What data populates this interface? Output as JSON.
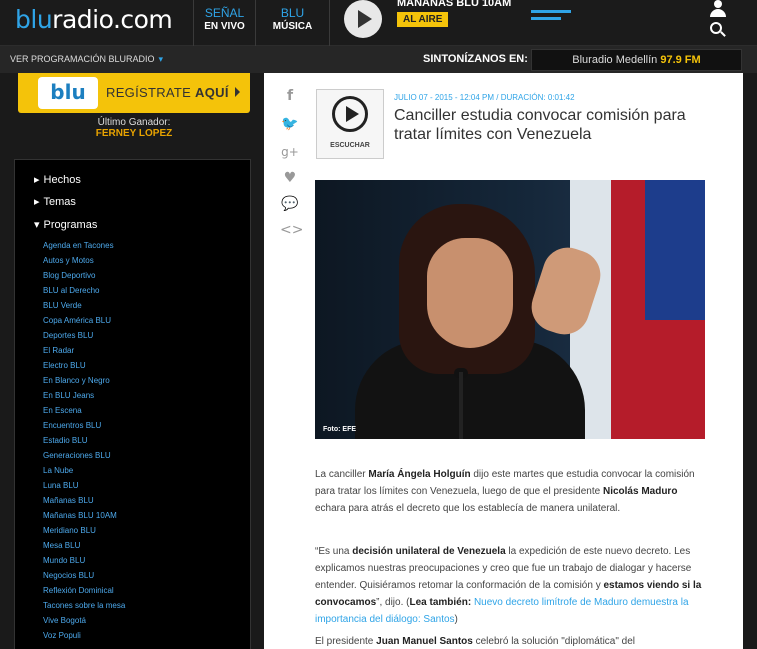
{
  "header": {
    "logo_main": "blu",
    "logo_rest": "radio.com",
    "tab_live": {
      "line1": "SEÑAL",
      "line2": "EN VIVO"
    },
    "tab_music": {
      "line1": "BLU",
      "line2": "MÚSICA"
    },
    "now_show": "MAÑANAS BLU 10AM",
    "live_badge": "AL AIRE"
  },
  "subbar": {
    "schedule_link": "VER PROGRAMACIÓN BLURADIO",
    "schedule_chevron": "▾",
    "tune_label": "SINTONÍZANOS EN:",
    "station_name": "Bluradio Medellín",
    "station_freq": "97.9 FM"
  },
  "sidebar": {
    "register_logo": "blu",
    "register_text": "REGÍSTRATE",
    "register_bold": "AQUÍ",
    "winner_label": "Último Ganador:",
    "winner_name": "FERNEY LOPEZ",
    "sections": {
      "hechos": "Hechos",
      "temas": "Temas",
      "programas": "Programas"
    },
    "programs": [
      "Agenda en Tacones",
      "Autos y Motos",
      "Blog Deportivo",
      "BLU al Derecho",
      "BLU Verde",
      "Copa América BLU",
      "Deportes BLU",
      "El Radar",
      "Electro BLU",
      "En Blanco y Negro",
      "En BLU Jeans",
      "En Escena",
      "Encuentros BLU",
      "Estadio BLU",
      "Generaciones BLU",
      "La Nube",
      "Luna BLU",
      "Mañanas BLU",
      "Mañanas BLU 10AM",
      "Meridiano BLU",
      "Mesa BLU",
      "Mundo BLU",
      "Negocios BLU",
      "Reflexión Dominical",
      "Tacones sobre la mesa",
      "Vive Bogotá",
      "Voz Populi"
    ]
  },
  "article": {
    "share": {
      "facebook": "f",
      "twitter": "🐦",
      "googleplus": "g+",
      "like": "♥",
      "comment": "💬",
      "embed": "<>"
    },
    "listen_label": "ESCUCHAR",
    "meta": "JULIO 07 - 2015 - 12:04 PM / DURACIÓN: 0:01:42",
    "headline": "Canciller estudia convocar comisión para tratar límites con Venezuela",
    "photo_credit": "Foto: EFE",
    "p1": {
      "a": "La canciller ",
      "b": "María Ángela Holguín",
      "c": " dijo este martes que estudia convocar la comisión para tratar los límites con Venezuela, luego de que el presidente ",
      "d": "Nicolás Maduro",
      "e": " echara para atrás el decreto que los establecía de manera unilateral."
    },
    "p2": {
      "a": "“Es una ",
      "b": "decisión unilateral de Venezuela",
      "c": " la expedición de este nuevo decreto. Les explicamos nuestras preocupaciones y creo que fue un trabajo de dialogar y hacerse entender. Quisiéramos retomar la conformación de la comisión y ",
      "d": "estamos viendo si la convocamos",
      "e": "”, dijo. (",
      "f": "Lea también:",
      "g": " ",
      "link": "Nuevo decreto limítrofe de Maduro demuestra la importancia del diálogo: Santos",
      "h": ")"
    },
    "p3": {
      "a": "El presidente ",
      "b": "Juan Manuel Santos",
      "c": " celebró la solución \"diplomática\" del"
    }
  },
  "colors": {
    "accent": "#2fa4e7",
    "brand_yellow": "#f4c30a"
  }
}
